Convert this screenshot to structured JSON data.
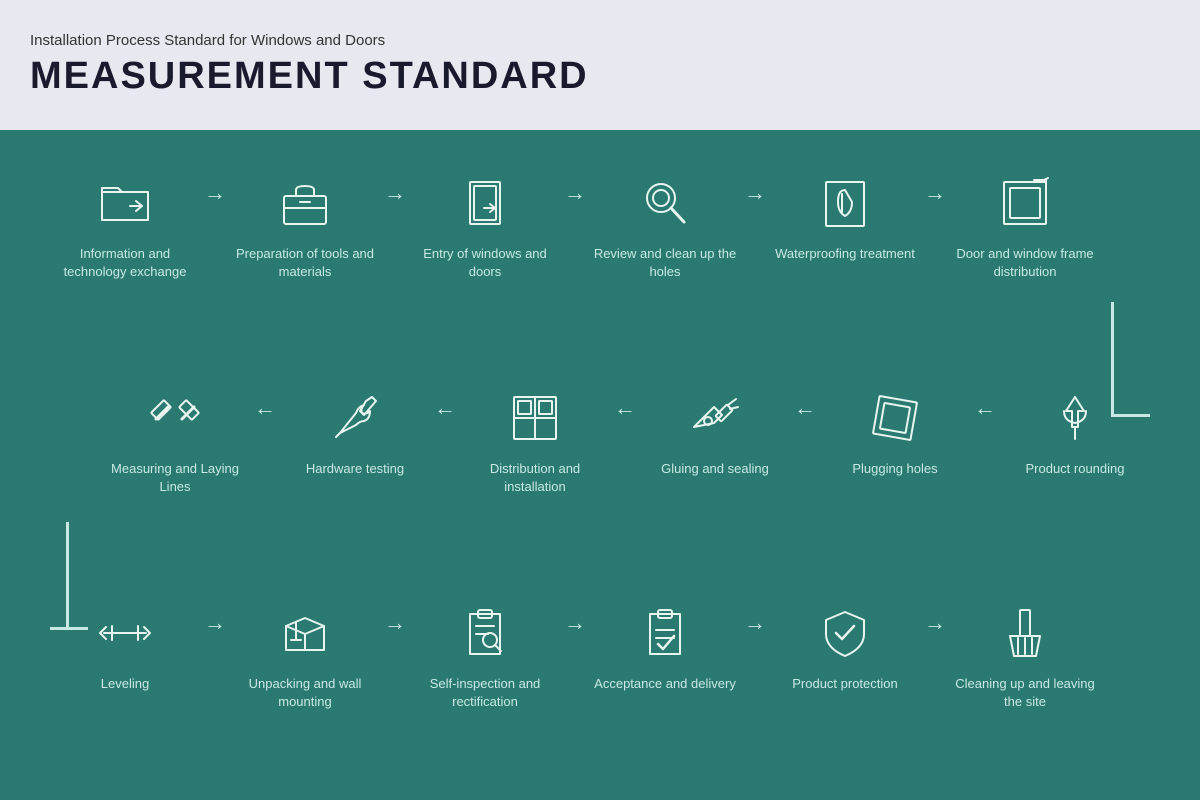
{
  "header": {
    "subtitle": "Installation Process Standard for Windows and Doors",
    "title": "MEASUREMENT STANDARD"
  },
  "colors": {
    "bg_main": "#2a7a72",
    "bg_header": "#e8e8f0",
    "icon_stroke": "#e8f4f0",
    "label_color": "#c8e8e4"
  },
  "row1": [
    {
      "id": "info-exchange",
      "label": "Information and technology exchange",
      "icon": "folder-share"
    },
    {
      "id": "prep-tools",
      "label": "Preparation of tools and materials",
      "icon": "toolbox"
    },
    {
      "id": "entry-windows",
      "label": "Entry of windows and doors",
      "icon": "door-entry"
    },
    {
      "id": "review-holes",
      "label": "Review and clean up the holes",
      "icon": "search-hole"
    },
    {
      "id": "waterproofing",
      "label": "Waterproofing treatment",
      "icon": "waterproof"
    },
    {
      "id": "frame-dist",
      "label": "Door and window frame distribution",
      "icon": "frame-dist"
    }
  ],
  "row2": [
    {
      "id": "measuring",
      "label": "Measuring and Laying Lines",
      "icon": "measure"
    },
    {
      "id": "hardware-test",
      "label": "Hardware testing",
      "icon": "hardware"
    },
    {
      "id": "distribution-install",
      "label": "Distribution and installation",
      "icon": "distribution"
    },
    {
      "id": "gluing",
      "label": "Gluing and sealing",
      "icon": "glue"
    },
    {
      "id": "plugging",
      "label": "Plugging holes",
      "icon": "plug"
    },
    {
      "id": "product-round",
      "label": "Product rounding",
      "icon": "round"
    }
  ],
  "row3": [
    {
      "id": "leveling",
      "label": "Leveling",
      "icon": "level"
    },
    {
      "id": "unpacking",
      "label": "Unpacking and wall mounting",
      "icon": "unpack"
    },
    {
      "id": "self-inspect",
      "label": "Self-inspection and rectification",
      "icon": "inspect"
    },
    {
      "id": "acceptance",
      "label": "Acceptance and delivery",
      "icon": "accept"
    },
    {
      "id": "product-protect",
      "label": "Product protection",
      "icon": "protect"
    },
    {
      "id": "cleanup",
      "label": "Cleaning up and leaving the site",
      "icon": "cleanup"
    }
  ]
}
